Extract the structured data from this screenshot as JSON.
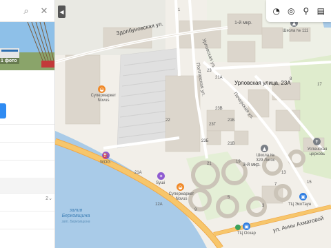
{
  "search": {
    "value": "",
    "placeholder": ""
  },
  "photo": {
    "count_label": "1 фото"
  },
  "list": {
    "row_count": "2"
  },
  "address": {
    "label": "Урловская улица, 23А"
  },
  "streets": {
    "zdolbunovska": "Здолбуновская ул.",
    "poltavska": "Полтавская ул.",
    "urlovska_side": "Урловская ул.",
    "pecherska": "Печерская ул.",
    "ahmatova": "ул. Анны Ахматовой"
  },
  "districts": {
    "mkr1": "1-й мкр.",
    "mkr3": "3-й мкр."
  },
  "pois": {
    "school111": "Школа № 111",
    "novus_top": "Супермаркет Novus",
    "wog": "WOG",
    "silpo": "Sушi",
    "novus_bottom": "Супермаркет Novus",
    "school329": "Школа № 329 Логос",
    "uspenska": "Успенская церковь",
    "tc_echotaun": "ТЦ ЭкоТаун",
    "tc_oskar": "ТЦ Оскар"
  },
  "water": {
    "line1": "залив",
    "line2": "Берковщина",
    "line3": "зат. Берковщина"
  },
  "house_numbers": [
    "23",
    "1",
    "8",
    "17",
    "21А",
    "23В",
    "23Г",
    "21Б",
    "23Б",
    "21В",
    "13",
    "15",
    "21",
    "22",
    "21А",
    "12А",
    "5",
    "3",
    "9",
    "19",
    "7"
  ],
  "toolbar": [
    "layers-icon",
    "transit-icon",
    "bicycle-icon",
    "bus-icon"
  ],
  "colors": {
    "pin": "#ef2b2d",
    "accent": "#2f8bf2",
    "road_major": "#f7c66b",
    "water": "#a9cbe8"
  }
}
